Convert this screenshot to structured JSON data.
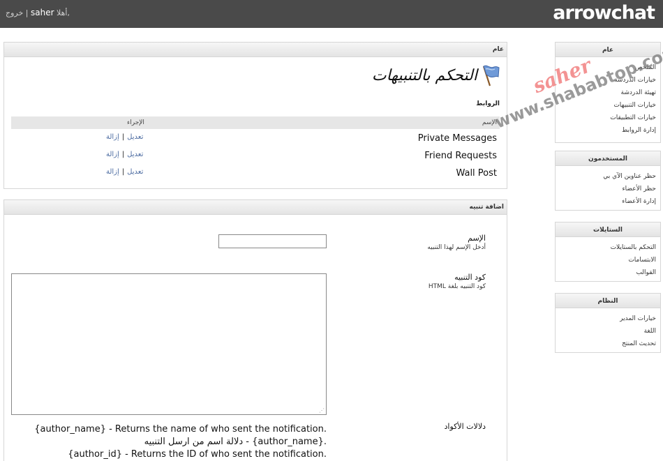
{
  "topbar": {
    "logo": "arrowchat",
    "greeting": "أهلا,",
    "username": "saher",
    "separator": "|",
    "logout": "خروج"
  },
  "sidebar": {
    "general": {
      "title": "عام",
      "items": [
        "الملخص",
        "خيارات الدردشة",
        "تهيئة الدردشة",
        "خيارات التنبيهات",
        "خيارات التطبيقات",
        "إدارة الروابط"
      ]
    },
    "users": {
      "title": "المستخدمون",
      "items": [
        "حظر عناوين الآي بي",
        "حظر الأعضاء",
        "إدارة الأعضاء"
      ]
    },
    "styles": {
      "title": "الستايلات",
      "items": [
        "التحكم بالستايلات",
        "الابتسامات",
        "القوالب"
      ]
    },
    "system": {
      "title": "النظام",
      "items": [
        "خيارات المدير",
        "اللغة",
        "تحديث المنتج"
      ]
    }
  },
  "main": {
    "section_title": "عام",
    "page_title": "التحكم بالتنبيهات",
    "links_label": "الروابط",
    "table": {
      "col_name": "الإسم",
      "col_action": "الإجراء",
      "edit": "تعديل",
      "delete": "إزالة",
      "rows": [
        "Private Messages",
        "Friend Requests",
        "Wall Post"
      ]
    }
  },
  "add": {
    "section_title": "اضافة تنبيه",
    "name_label": "الإسم",
    "name_hint": "أدخل الإسم لهذا التنبيه",
    "name_value": "",
    "code_label": "كود التنبيه",
    "code_hint": "كود التنبيه بلغة HTML",
    "code_value": "",
    "codes_label": "دلالات الأكواد",
    "codes": [
      "{author_name} - Returns the name of who sent the notification.",
      "دلالة اسم من ارسل التنبيه - {author_name}.",
      "{author_id} - Returns the ID of who sent the notification."
    ]
  },
  "watermark": {
    "site": "www.shababtop.com",
    "name": "saher"
  }
}
